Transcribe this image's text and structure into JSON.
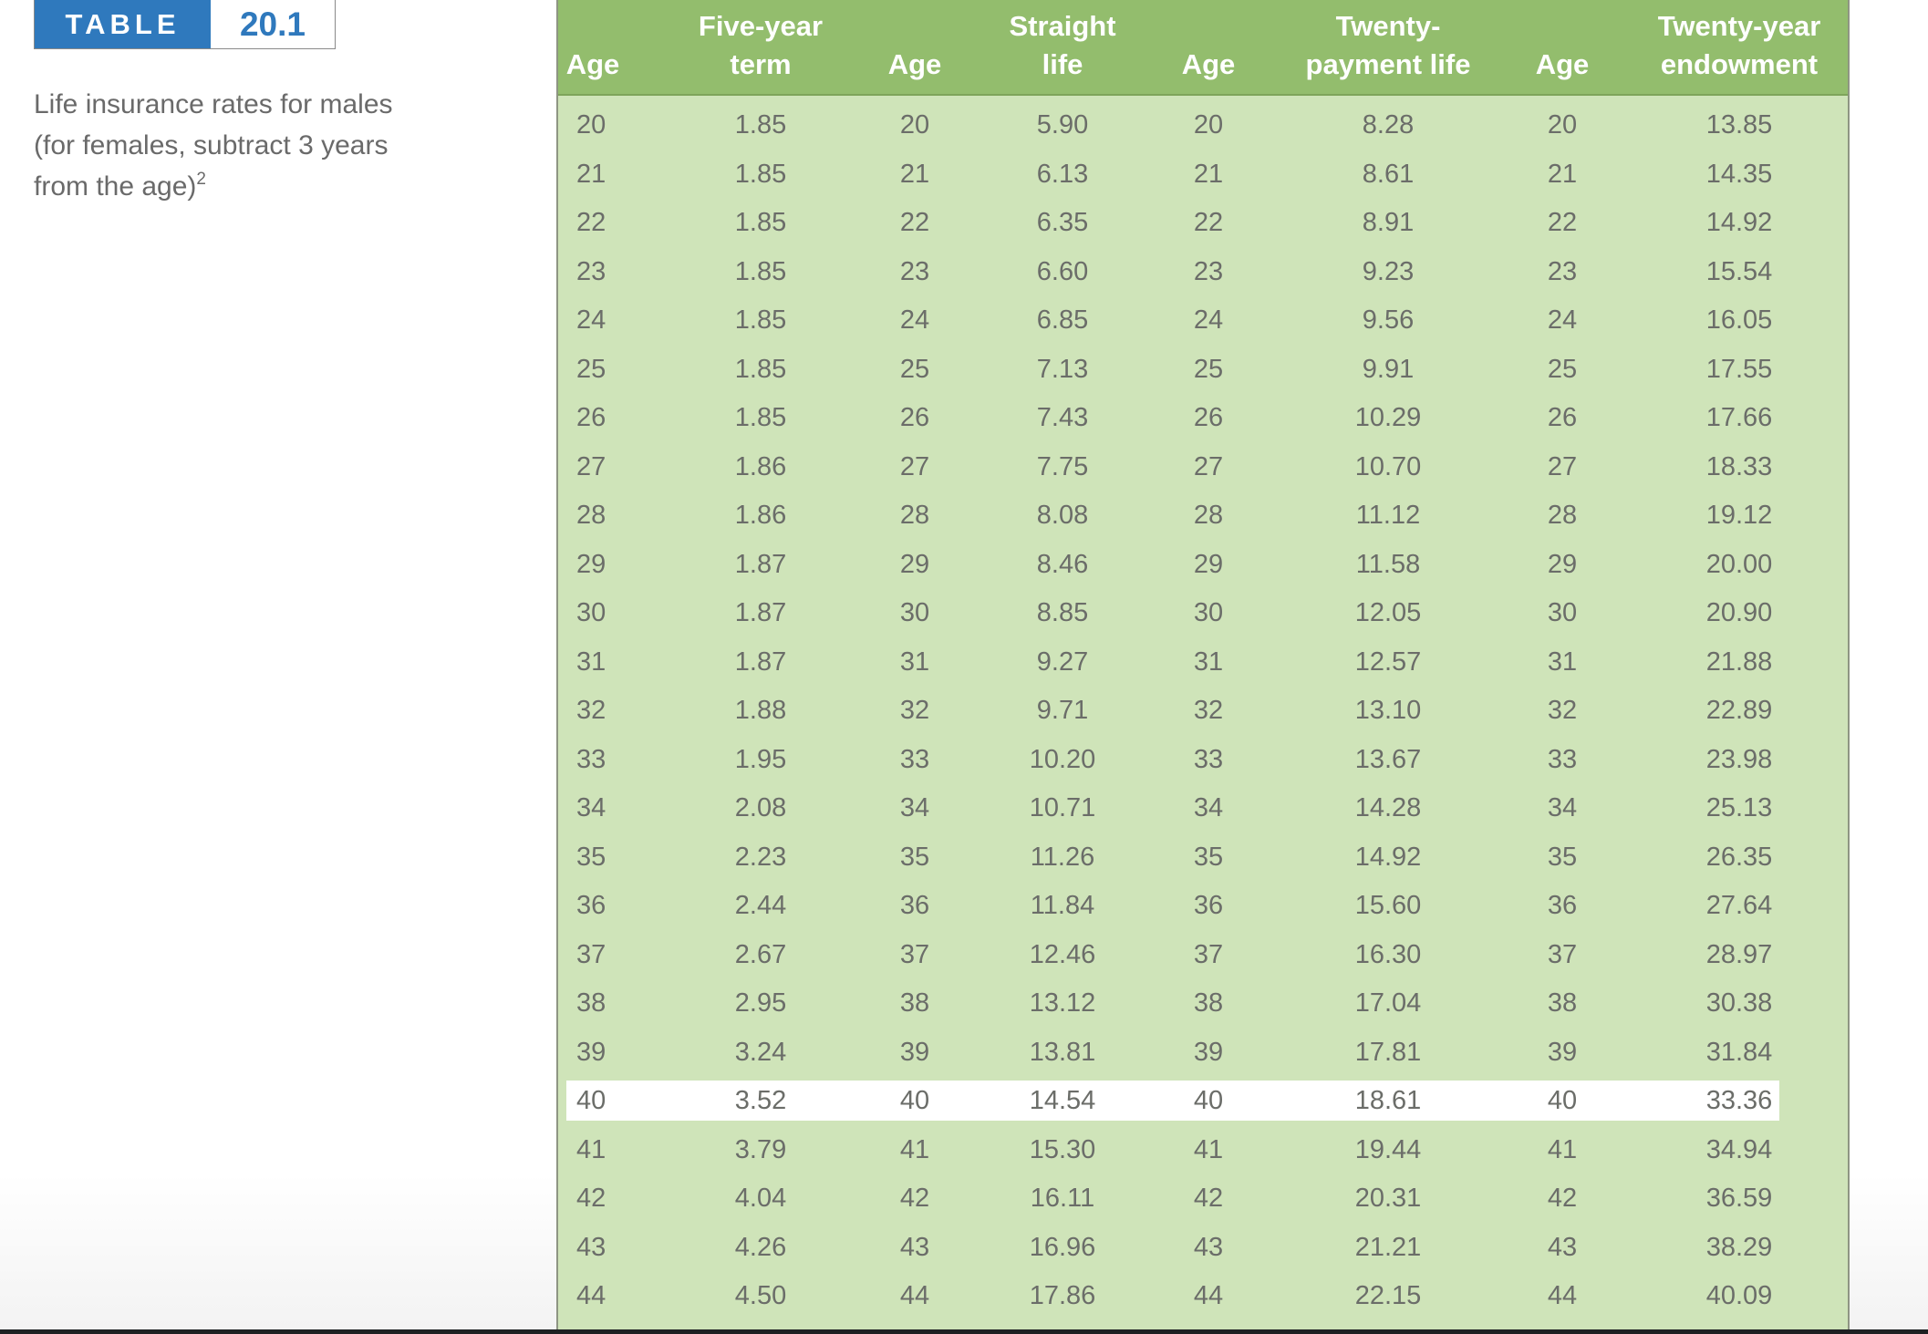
{
  "badge": {
    "label": "TABLE",
    "number": "20.1"
  },
  "caption": {
    "text": "Life insurance rates for males (for females, subtract 3 years from the age)",
    "footnote_ref": "2"
  },
  "table": {
    "headers": [
      {
        "lines": [
          "",
          "Age"
        ]
      },
      {
        "lines": [
          "Five-year",
          "term"
        ]
      },
      {
        "lines": [
          "",
          "Age"
        ]
      },
      {
        "lines": [
          "Straight",
          "life"
        ]
      },
      {
        "lines": [
          "",
          "Age"
        ]
      },
      {
        "lines": [
          "Twenty-",
          "payment life"
        ]
      },
      {
        "lines": [
          "",
          "Age"
        ]
      },
      {
        "lines": [
          "Twenty-year",
          "endowment"
        ]
      }
    ],
    "highlighted_age": "40",
    "rows": [
      [
        "20",
        "1.85",
        "20",
        "5.90",
        "20",
        "8.28",
        "20",
        "13.85"
      ],
      [
        "21",
        "1.85",
        "21",
        "6.13",
        "21",
        "8.61",
        "21",
        "14.35"
      ],
      [
        "22",
        "1.85",
        "22",
        "6.35",
        "22",
        "8.91",
        "22",
        "14.92"
      ],
      [
        "23",
        "1.85",
        "23",
        "6.60",
        "23",
        "9.23",
        "23",
        "15.54"
      ],
      [
        "24",
        "1.85",
        "24",
        "6.85",
        "24",
        "9.56",
        "24",
        "16.05"
      ],
      [
        "25",
        "1.85",
        "25",
        "7.13",
        "25",
        "9.91",
        "25",
        "17.55"
      ],
      [
        "26",
        "1.85",
        "26",
        "7.43",
        "26",
        "10.29",
        "26",
        "17.66"
      ],
      [
        "27",
        "1.86",
        "27",
        "7.75",
        "27",
        "10.70",
        "27",
        "18.33"
      ],
      [
        "28",
        "1.86",
        "28",
        "8.08",
        "28",
        "11.12",
        "28",
        "19.12"
      ],
      [
        "29",
        "1.87",
        "29",
        "8.46",
        "29",
        "11.58",
        "29",
        "20.00"
      ],
      [
        "30",
        "1.87",
        "30",
        "8.85",
        "30",
        "12.05",
        "30",
        "20.90"
      ],
      [
        "31",
        "1.87",
        "31",
        "9.27",
        "31",
        "12.57",
        "31",
        "21.88"
      ],
      [
        "32",
        "1.88",
        "32",
        "9.71",
        "32",
        "13.10",
        "32",
        "22.89"
      ],
      [
        "33",
        "1.95",
        "33",
        "10.20",
        "33",
        "13.67",
        "33",
        "23.98"
      ],
      [
        "34",
        "2.08",
        "34",
        "10.71",
        "34",
        "14.28",
        "34",
        "25.13"
      ],
      [
        "35",
        "2.23",
        "35",
        "11.26",
        "35",
        "14.92",
        "35",
        "26.35"
      ],
      [
        "36",
        "2.44",
        "36",
        "11.84",
        "36",
        "15.60",
        "36",
        "27.64"
      ],
      [
        "37",
        "2.67",
        "37",
        "12.46",
        "37",
        "16.30",
        "37",
        "28.97"
      ],
      [
        "38",
        "2.95",
        "38",
        "13.12",
        "38",
        "17.04",
        "38",
        "30.38"
      ],
      [
        "39",
        "3.24",
        "39",
        "13.81",
        "39",
        "17.81",
        "39",
        "31.84"
      ],
      [
        "40",
        "3.52",
        "40",
        "14.54",
        "40",
        "18.61",
        "40",
        "33.36"
      ],
      [
        "41",
        "3.79",
        "41",
        "15.30",
        "41",
        "19.44",
        "41",
        "34.94"
      ],
      [
        "42",
        "4.04",
        "42",
        "16.11",
        "42",
        "20.31",
        "42",
        "36.59"
      ],
      [
        "43",
        "4.26",
        "43",
        "16.96",
        "43",
        "21.21",
        "43",
        "38.29"
      ],
      [
        "44",
        "4.50",
        "44",
        "17.86",
        "44",
        "22.15",
        "44",
        "40.09"
      ]
    ]
  },
  "colors": {
    "badge_blue": "#2f79bd",
    "header_green": "#93bd6d",
    "body_green": "#cfe4b9",
    "highlight_row": "#ffffff",
    "cell_text": "#6b6d69"
  }
}
